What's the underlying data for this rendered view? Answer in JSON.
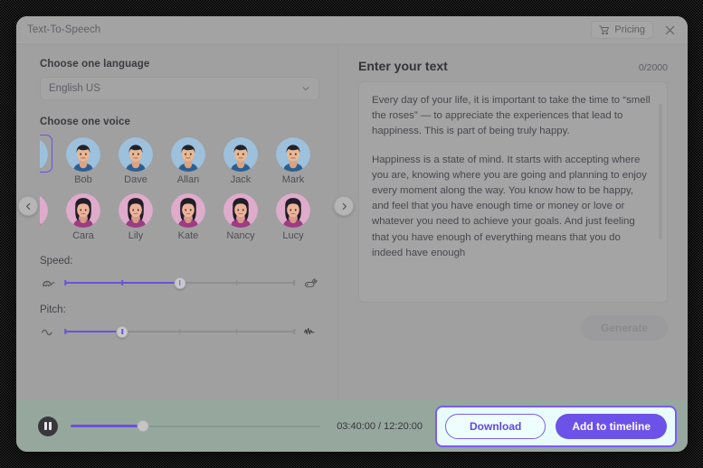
{
  "window": {
    "title": "Text-To-Speech",
    "pricing_label": "Pricing",
    "pricing_icon": "shopping-cart-icon",
    "close_icon": "close-icon"
  },
  "left": {
    "language_label": "Choose one language",
    "language_value": "English US",
    "language_chevron": "chevron-down-icon",
    "voice_label": "Choose one voice",
    "prev_icon": "chevron-left-icon",
    "next_icon": "chevron-right-icon",
    "voices_row1": [
      {
        "name": "Bob",
        "gender": "male"
      },
      {
        "name": "Dave",
        "gender": "male"
      },
      {
        "name": "Allan",
        "gender": "male"
      },
      {
        "name": "Jack",
        "gender": "male"
      },
      {
        "name": "Mark",
        "gender": "male"
      }
    ],
    "voices_row2": [
      {
        "name": "Cara",
        "gender": "female"
      },
      {
        "name": "Lily",
        "gender": "female"
      },
      {
        "name": "Kate",
        "gender": "female"
      },
      {
        "name": "Nancy",
        "gender": "female"
      },
      {
        "name": "Lucy",
        "gender": "female"
      }
    ],
    "speed": {
      "label": "Speed:",
      "value_pct": 50,
      "left_icon": "turtle-icon",
      "right_icon": "rabbit-icon",
      "ticks_pct": [
        0,
        25,
        50,
        75,
        100
      ]
    },
    "pitch": {
      "label": "Pitch:",
      "value_pct": 25,
      "left_icon": "sine-wave-icon",
      "right_icon": "waveform-icon",
      "ticks_pct": [
        0,
        25,
        50,
        75,
        100
      ]
    }
  },
  "right": {
    "title": "Enter your text",
    "counter": "0/2000",
    "paragraph_1": "Every day of your life, it is important to take the time to “smell the roses” — to appreciate the experiences that lead to happiness. This is part of being truly happy.",
    "paragraph_2": "Happiness is a state of mind. It starts with accepting where you are, knowing where you are going and planning to enjoy every moment along the way. You know how to be happy, and feel that you have enough time or money or love or whatever you need to achieve your goals. And just feeling that you have enough of everything means that you do indeed have enough",
    "generate_label": "Generate"
  },
  "player": {
    "play_icon": "pause-icon",
    "progress_pct": 29,
    "time_label": "03:40:00 / 12:20:00",
    "download_label": "Download",
    "timeline_label": "Add to timeline"
  },
  "colors": {
    "accent_purple": "#6c52d9",
    "timeline_button": "#6c52e8",
    "highlight_border": "#7b5cf0",
    "highlight_bg": "#e8fdfb",
    "bottom_bar": "#96a79e",
    "avatar_male_bg": "#9dc0dc",
    "avatar_female_bg": "#dfabcb"
  }
}
